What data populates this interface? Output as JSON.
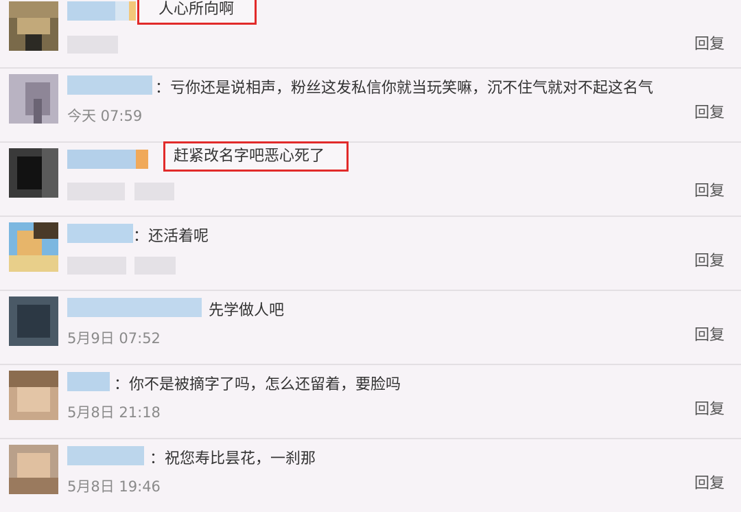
{
  "reply_label": "回复",
  "comments": [
    {
      "text": "人心所向啊",
      "time": "",
      "highlighted": true
    },
    {
      "text": "：亏你还是说相声，粉丝这发私信你就当玩笑嘛，沉不住气就对不起这名气",
      "time": "今天 07:59",
      "highlighted": false
    },
    {
      "text": "赶紧改名字吧恶心死了",
      "time": "",
      "highlighted": true
    },
    {
      "text": "：还活着呢",
      "time": "",
      "highlighted": false
    },
    {
      "text": "先学做人吧",
      "time": "5月9日 07:52",
      "highlighted": false
    },
    {
      "text": "：你不是被摘字了吗，怎么还留着，要脸吗",
      "time": "5月8日 21:18",
      "highlighted": false
    },
    {
      "text": "：祝您寿比昙花，一刹那",
      "time": "5月8日 19:46",
      "highlighted": false
    }
  ]
}
